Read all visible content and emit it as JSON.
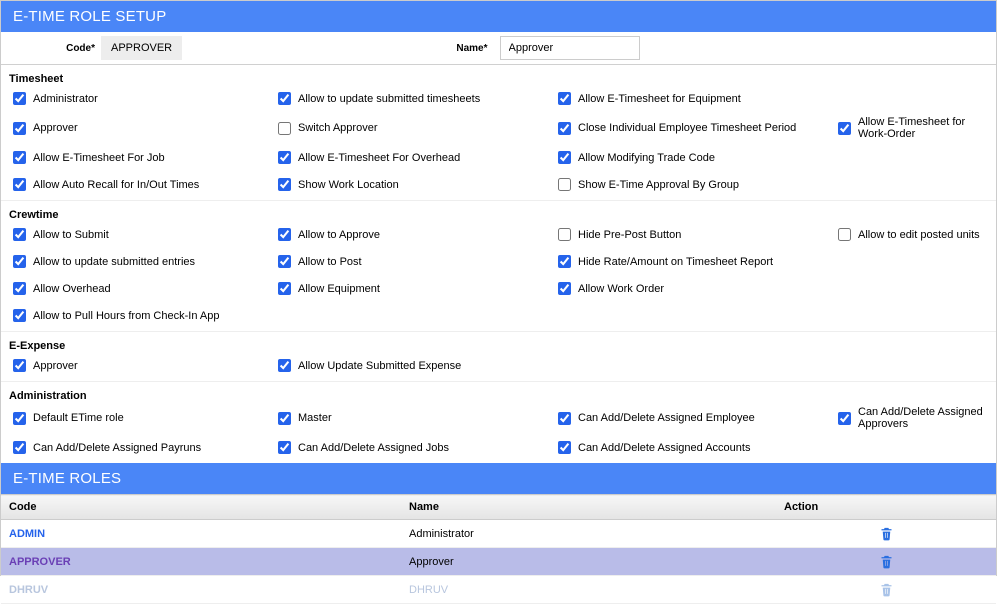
{
  "header": {
    "setup_title": "E-TIME ROLE SETUP",
    "roles_title": "E-TIME ROLES"
  },
  "form": {
    "code_label": "Code*",
    "code_value": "APPROVER",
    "name_label": "Name*",
    "name_value": "Approver"
  },
  "sections": {
    "timesheet": {
      "title": "Timesheet"
    },
    "crewtime": {
      "title": "Crewtime"
    },
    "eexpense": {
      "title": "E-Expense"
    },
    "admin": {
      "title": "Administration"
    }
  },
  "timesheet": {
    "r0c0": "Administrator",
    "r0c1": "Allow to update submitted timesheets",
    "r0c2": "Allow E-Timesheet for Equipment",
    "r1c0": "Approver",
    "r1c1": "Switch Approver",
    "r1c2": "Close Individual Employee Timesheet Period",
    "r1c3": "Allow E-Timesheet for Work-Order",
    "r2c0": "Allow E-Timesheet For Job",
    "r2c1": "Allow E-Timesheet For Overhead",
    "r2c2": "Allow Modifying Trade Code",
    "r3c0": "Allow Auto Recall for In/Out Times",
    "r3c1": "Show Work Location",
    "r3c2": "Show E-Time Approval By Group"
  },
  "crewtime": {
    "r0c0": "Allow to Submit",
    "r0c1": "Allow to Approve",
    "r0c2": "Hide Pre-Post Button",
    "r0c3": "Allow to edit posted units",
    "r1c0": "Allow to update submitted entries",
    "r1c1": "Allow to Post",
    "r1c2": "Hide Rate/Amount on Timesheet Report",
    "r2c0": "Allow Overhead",
    "r2c1": "Allow Equipment",
    "r2c2": "Allow Work Order",
    "r3c0": "Allow to Pull Hours from Check-In App"
  },
  "eexpense": {
    "r0c0": "Approver",
    "r0c1": "Allow Update Submitted Expense"
  },
  "admin": {
    "r0c0": "Default ETime role",
    "r0c1": "Master",
    "r0c2": "Can Add/Delete Assigned Employee",
    "r0c3": "Can Add/Delete Assigned Approvers",
    "r1c0": "Can Add/Delete Assigned Payruns",
    "r1c1": "Can Add/Delete Assigned Jobs",
    "r1c2": "Can Add/Delete Assigned Accounts"
  },
  "roles_table": {
    "columns": {
      "code": "Code",
      "name": "Name",
      "action": "Action"
    },
    "rows": [
      {
        "code": "ADMIN",
        "name": "Administrator"
      },
      {
        "code": "APPROVER",
        "name": "Approver"
      },
      {
        "code": "DHRUV",
        "name": "DHRUV"
      }
    ]
  }
}
